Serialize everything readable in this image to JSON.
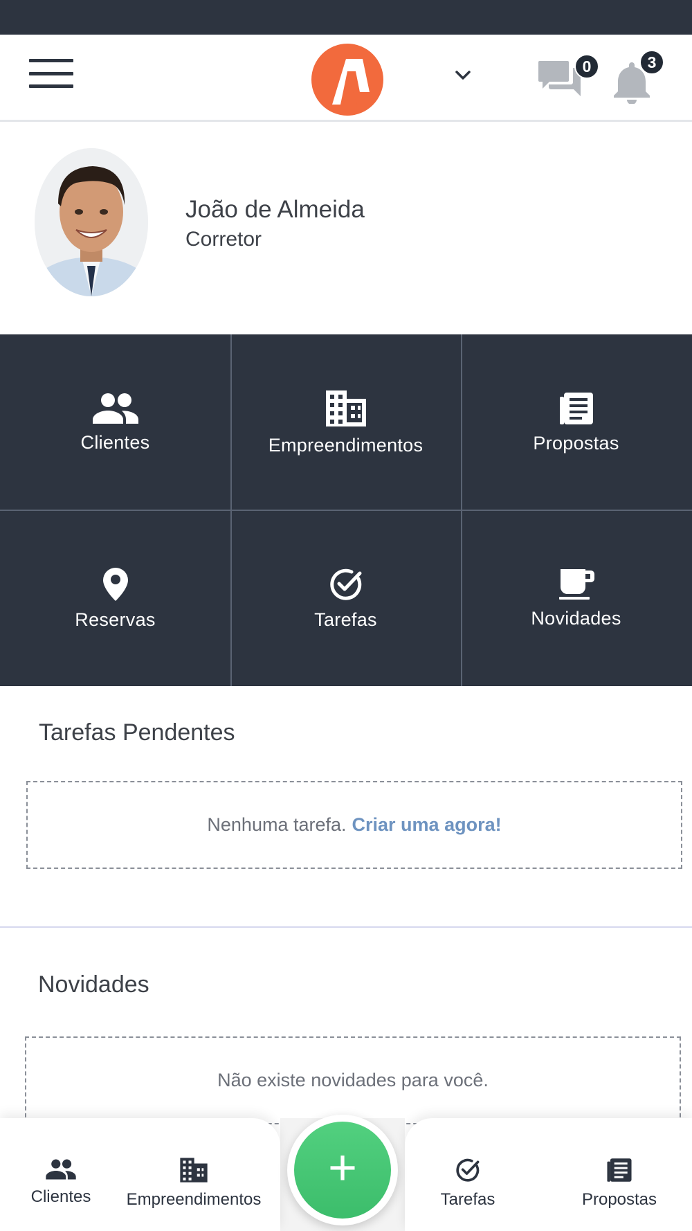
{
  "header": {
    "menu_icon": "hamburger-menu-icon",
    "logo_icon": "app-logo",
    "dropdown_icon": "chevron-down-icon",
    "messages_icon": "chat-bubbles-icon",
    "messages_count": "0",
    "notifications_icon": "bell-icon",
    "notifications_count": "3",
    "brand_color": "#f26a3d"
  },
  "profile": {
    "name": "João de Almeida",
    "role": "Corretor"
  },
  "shortcuts": [
    {
      "label": "Clientes",
      "icon": "people-icon"
    },
    {
      "label": "Empreendimentos",
      "icon": "building-icon"
    },
    {
      "label": "Propostas",
      "icon": "document-list-icon"
    },
    {
      "label": "Reservas",
      "icon": "location-pin-icon"
    },
    {
      "label": "Tarefas",
      "icon": "check-circle-icon"
    },
    {
      "label": "Novidades",
      "icon": "coffee-cup-icon"
    }
  ],
  "tasks": {
    "title": "Tarefas Pendentes",
    "empty_text": "Nenhuma tarefa.",
    "create_link": "Criar uma agora!"
  },
  "news": {
    "title": "Novidades",
    "empty_text": "Não existe novidades para você."
  },
  "bottom_nav": {
    "items": [
      {
        "label": "Clientes",
        "icon": "people-icon"
      },
      {
        "label": "Empreendimentos",
        "icon": "building-icon"
      },
      {
        "label": "Tarefas",
        "icon": "check-circle-icon"
      },
      {
        "label": "Propostas",
        "icon": "document-list-icon"
      }
    ],
    "fab_label": "+",
    "fab_color": "#46c574"
  }
}
